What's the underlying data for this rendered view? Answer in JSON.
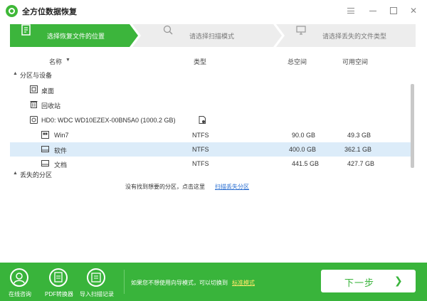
{
  "app": {
    "title": "全方位数据恢复"
  },
  "steps": [
    {
      "label": "选择恢复文件的位置",
      "icon": "document-icon",
      "active": true
    },
    {
      "label": "请选择扫描模式",
      "icon": "search-icon",
      "active": false
    },
    {
      "label": "请选择丢失的文件类型",
      "icon": "monitor-icon",
      "active": false
    }
  ],
  "table": {
    "headers": {
      "name": "名称",
      "type": "类型",
      "total": "总空间",
      "available": "可用空间"
    }
  },
  "tree": {
    "group_partitions": "分区与设备",
    "desktop": "桌面",
    "recycle": "回收站",
    "disk": "HD0: WDC WD10EZEX-00BN5A0 (1000.2 GB)",
    "partitions": [
      {
        "name": "Win7",
        "type": "NTFS",
        "total": "90.0 GB",
        "available": "49.3 GB"
      },
      {
        "name": "软件",
        "type": "NTFS",
        "total": "400.0 GB",
        "available": "362.1 GB"
      },
      {
        "name": "文档",
        "type": "NTFS",
        "total": "441.5 GB",
        "available": "427.7 GB"
      }
    ],
    "group_lost": "丢失的分区"
  },
  "hint": {
    "text": "没有找到想要的分区，点击这里",
    "link": "扫描丢失分区"
  },
  "footer": {
    "online_consult": "在线咨询",
    "pdf_converter": "PDF转换器",
    "import_records": "导入扫描记录",
    "guide_text": "如果您不想使用向导模式，可以切换到",
    "standard_mode": "标准模式",
    "next": "下一步",
    "next_arrow": "❯"
  },
  "colors": {
    "brand_green": "#39b43b",
    "step_active": "#3cb53c",
    "selected_row": "#dcecf9",
    "link_blue": "#2b6fd1"
  }
}
